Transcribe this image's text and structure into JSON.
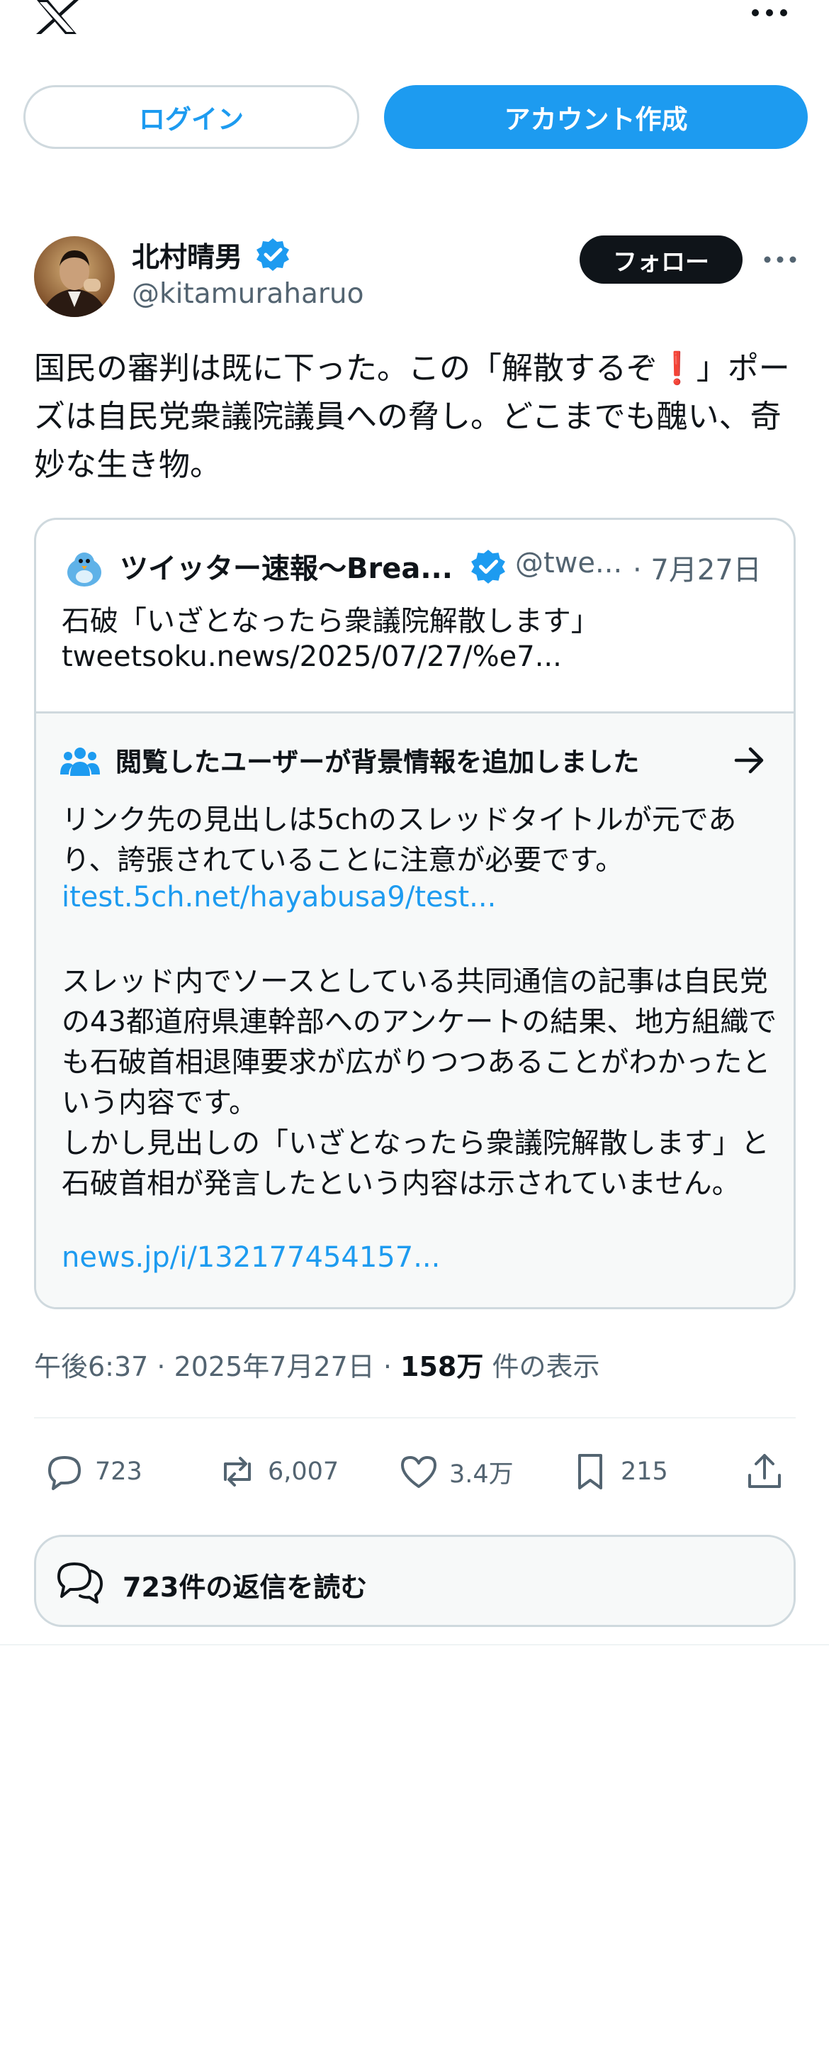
{
  "header": {
    "logo_icon": "x-logo-icon",
    "more_icon": "more-horizontal-icon"
  },
  "auth": {
    "login_label": "ログイン",
    "signup_label": "アカウント作成"
  },
  "post": {
    "author_name": "北村晴男",
    "author_handle": "@kitamuraharuo",
    "follow_label": "フォロー",
    "text_part1": "国民の審判は既に下った。この「解散するぞ",
    "text_emoji": "❗",
    "text_part2": "」ポーズは自民党衆議院議員への脅し。どこまでも醜い、奇妙な生き物。",
    "quote": {
      "name": "ツイッター速報〜Brea...",
      "handle": "@twe...",
      "date": "· 7月27日",
      "text": "石破「いざとなったら衆議院解散します」",
      "link": "tweetsoku.news/2025/07/27/%e7..."
    },
    "community_note": {
      "title": "閲覧したユーザーが背景情報を追加しました",
      "paragraph1": "リンク先の見出しは5chのスレッドタイトルが元であり、誇張されていることに注意が必要です。",
      "link1": "itest.5ch.net/hayabusa9/test...",
      "paragraph2a": "スレッド内でソースとしている共同通信の記事は自民党の43都道府県連幹部へのアンケートの結果、地方組織でも石破首相退陣要求が広がりつつあることがわかったという内容です。",
      "paragraph2b": "しかし見出しの「いざとなったら衆議院解散します」と石破首相が発言したという内容は示されていません。",
      "link2": "news.jp/i/132177454157..."
    },
    "timestamp": "午後6:37 · 2025年7月27日 · ",
    "views_count": "158万",
    "views_label": " 件の表示",
    "stats": {
      "replies": "723",
      "reposts": "6,007",
      "likes": "3.4万",
      "bookmarks": "215"
    },
    "read_replies_label": "723件の返信を読む"
  },
  "colors": {
    "accent": "#1d9bf0",
    "text": "#0f1419",
    "muted": "#536471",
    "border": "#cfd9de"
  }
}
